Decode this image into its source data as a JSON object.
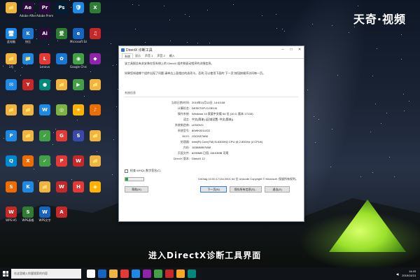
{
  "watermark": "天奇·视频",
  "caption": "进入DirectX诊断工具界面",
  "desktop_icons": [
    {
      "label": "",
      "color": "#f2b440",
      "glyph": "📁"
    },
    {
      "label": "Adobe After Effects C...",
      "color": "#2b0a3d",
      "glyph": "Ae"
    },
    {
      "label": "Adobe Premiere P...",
      "color": "#2b0a3d",
      "glyph": "Pr"
    },
    {
      "label": "",
      "color": "#001e36",
      "glyph": "Ps"
    },
    {
      "label": "",
      "color": "#1e88e5",
      "glyph": "🛡"
    },
    {
      "label": "",
      "color": "#2e7d32",
      "glyph": "X"
    },
    {
      "label": "此电脑",
      "color": "#1e88e5",
      "glyph": "🖥"
    },
    {
      "label": "快压",
      "color": "#1976d2",
      "glyph": "K"
    },
    {
      "label": "",
      "color": "#2b0a3d",
      "glyph": "Ai"
    },
    {
      "label": "",
      "color": "#2e7d32",
      "glyph": "爱"
    },
    {
      "label": "Microsoft Edge",
      "color": "#1565c0",
      "glyph": "e"
    },
    {
      "label": "",
      "color": "#c62828",
      "glyph": "♫"
    },
    {
      "label": "1号",
      "color": "#f2b440",
      "glyph": "📁"
    },
    {
      "label": "",
      "color": "#1e88e5",
      "glyph": "📁"
    },
    {
      "label": "Lenovo",
      "color": "#e53935",
      "glyph": "L"
    },
    {
      "label": "",
      "color": "#1976d2",
      "glyph": "✿"
    },
    {
      "label": "Google Chrome",
      "color": "#43a047",
      "glyph": "◉"
    },
    {
      "label": "",
      "color": "#8e24aa",
      "glyph": "◆"
    },
    {
      "label": "",
      "color": "#1e88e5",
      "glyph": "✉"
    },
    {
      "label": "",
      "color": "#c62828",
      "glyph": "Y"
    },
    {
      "label": "",
      "color": "#00897b",
      "glyph": "●"
    },
    {
      "label": "",
      "color": "#f2b440",
      "glyph": "📁"
    },
    {
      "label": "",
      "color": "#43a047",
      "glyph": "▶"
    },
    {
      "label": "",
      "color": "#f2b440",
      "glyph": "📁"
    },
    {
      "label": "",
      "color": "#f2b440",
      "glyph": "📁"
    },
    {
      "label": "",
      "color": "#f2b440",
      "glyph": "📁"
    },
    {
      "label": "",
      "color": "#1e88e5",
      "glyph": "W"
    },
    {
      "label": "",
      "color": "#7cb342",
      "glyph": "◎"
    },
    {
      "label": "",
      "color": "#ffb300",
      "glyph": "★"
    },
    {
      "label": "",
      "color": "#ef6c00",
      "glyph": "♪"
    },
    {
      "label": "",
      "color": "#1e88e5",
      "glyph": "P"
    },
    {
      "label": "",
      "color": "#f2b440",
      "glyph": "📁"
    },
    {
      "label": "",
      "color": "#43a047",
      "glyph": "✓"
    },
    {
      "label": "",
      "color": "#e53935",
      "glyph": "G"
    },
    {
      "label": "",
      "color": "#3949ab",
      "glyph": "S"
    },
    {
      "label": "",
      "color": "#f2b440",
      "glyph": "📁"
    },
    {
      "label": "",
      "color": "#0288d1",
      "glyph": "Q"
    },
    {
      "label": "",
      "color": "#ef6c00",
      "glyph": "X"
    },
    {
      "label": "",
      "color": "#43a047",
      "glyph": "✓"
    },
    {
      "label": "",
      "color": "#e53935",
      "glyph": "P"
    },
    {
      "label": "",
      "color": "#c62828",
      "glyph": "W"
    },
    {
      "label": "",
      "color": "#f2b440",
      "glyph": "📁"
    },
    {
      "label": "",
      "color": "#ef6c00",
      "glyph": "S"
    },
    {
      "label": "",
      "color": "#1e88e5",
      "glyph": "K"
    },
    {
      "label": "",
      "color": "#f2b440",
      "glyph": "📁"
    },
    {
      "label": "",
      "color": "#c62828",
      "glyph": "W"
    },
    {
      "label": "",
      "color": "#e53935",
      "glyph": "H"
    },
    {
      "label": "",
      "color": "#ffb300",
      "glyph": "◈"
    },
    {
      "label": "WPS H5",
      "color": "#c62828",
      "glyph": "W"
    },
    {
      "label": "WPS表格",
      "color": "#2e7d32",
      "glyph": "S"
    },
    {
      "label": "WPS文字",
      "color": "#1565c0",
      "glyph": "W"
    },
    {
      "label": "",
      "color": "#c62828",
      "glyph": "A"
    }
  ],
  "dialog": {
    "title": "DirectX 诊断工具",
    "tabs": [
      "系统",
      "显示",
      "声音 1",
      "声音 2",
      "输入"
    ],
    "intro": "该工具报告有关安装在您系统上的 DirectX 组件和驱动程序的详细信息。",
    "intro2": "如果您知道哪个组件出现了问题,请单击上面相应的选项卡。否则,可以使用下面的\"下一页\"按钮按顺序访问每一页。",
    "sysinfo_title": "系统信息",
    "rows": [
      {
        "k": "当前日期/时间:",
        "v": "2019年11月13日, 14:43:08"
      },
      {
        "k": "计算机名:",
        "v": "DESKTOP-OJ3E19I"
      },
      {
        "k": "操作系统:",
        "v": "Windows 10 家庭中文版 64 位 (10.0, 版本 17134)"
      },
      {
        "k": "语言:",
        "v": "中文(简体) (区域设置: 中文(简体))"
      },
      {
        "k": "系统制造商:",
        "v": "LENOVO"
      },
      {
        "k": "系统型号:",
        "v": "80WK001UCD"
      },
      {
        "k": "BIOS:",
        "v": "O3CN37WW"
      },
      {
        "k": "处理器:",
        "v": "Intel(R) Core(TM) i5-6300HQ CPU @ 2.80GHz (4 CPUs)"
      },
      {
        "k": "内存:",
        "v": "16384MB RAM"
      },
      {
        "k": "页面文件:",
        "v": "6290MB 已用, 18103MB 可用"
      },
      {
        "k": "DirectX 版本:",
        "v": "DirectX 12"
      }
    ],
    "whql_label": "检查 WHQL 数字签名(C)",
    "progress": 0.15,
    "copyright": "DxDiag 10.00.17134.0001 64 位 Unicode Copyright © Microsoft. 保留所有权利。",
    "buttons": {
      "help": "帮助(H)",
      "next": "下一页(N)",
      "save": "保存所有信息(S)...",
      "exit": "退出(X)"
    }
  },
  "taskbar": {
    "search_placeholder": "在这里输入你要搜索的内容",
    "time": "14:43",
    "date": "2019/11/13",
    "icons": [
      {
        "color": "#ffffff"
      },
      {
        "color": "#1565c0"
      },
      {
        "color": "#f2b440"
      },
      {
        "color": "#e53935"
      },
      {
        "color": "#1e88e5"
      },
      {
        "color": "#8e24aa"
      },
      {
        "color": "#43a047"
      },
      {
        "color": "#c62828"
      },
      {
        "color": "#f9a825"
      },
      {
        "color": "#00897b"
      }
    ]
  }
}
